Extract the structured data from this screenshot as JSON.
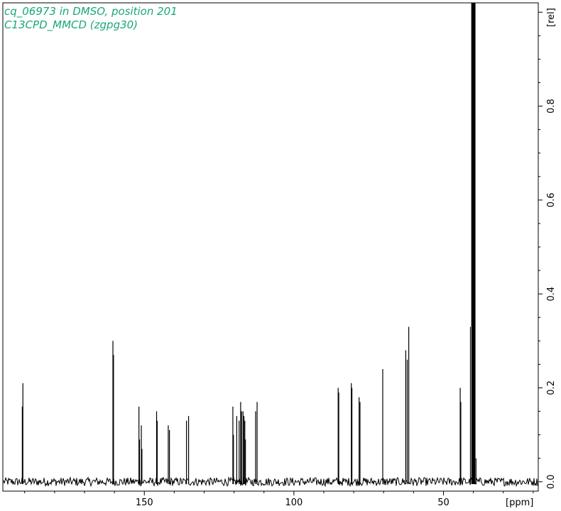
{
  "header": {
    "line1": "cq_06973 in DMSO, position 201",
    "line2": "C13CPD_MMCD (zgpg30)"
  },
  "colors": {
    "title": "#1aa874",
    "trace": "#000000",
    "frame": "#000000",
    "background": "#ffffff"
  },
  "chart_data": {
    "type": "line",
    "xlabel": "[ppm]",
    "ylabel": "[rel]",
    "x_reversed": true,
    "xlim": [
      197.3,
      18.3
    ],
    "ylim": [
      -0.02,
      1.02
    ],
    "x_ticks": [
      150,
      100,
      50
    ],
    "x_tick_labels": [
      "150",
      "100",
      "50"
    ],
    "y_ticks": [
      0.0,
      0.2,
      0.4,
      0.6,
      0.8
    ],
    "y_tick_labels": [
      "0.0",
      "0.2",
      "0.4",
      "0.6",
      "0.8"
    ],
    "solvent_peak": {
      "ppm_from": 39.3,
      "ppm_to": 40.7,
      "height": 1.02,
      "label": ""
    },
    "peaks": [
      {
        "ppm": 190.6,
        "height": 0.21
      },
      {
        "ppm": 190.8,
        "height": 0.16
      },
      {
        "ppm": 160.5,
        "height": 0.3
      },
      {
        "ppm": 160.3,
        "height": 0.27
      },
      {
        "ppm": 151.8,
        "height": 0.16
      },
      {
        "ppm": 151.6,
        "height": 0.09
      },
      {
        "ppm": 151.0,
        "height": 0.12
      },
      {
        "ppm": 150.8,
        "height": 0.07
      },
      {
        "ppm": 145.9,
        "height": 0.15
      },
      {
        "ppm": 145.7,
        "height": 0.13
      },
      {
        "ppm": 142.0,
        "height": 0.12
      },
      {
        "ppm": 141.6,
        "height": 0.11
      },
      {
        "ppm": 135.9,
        "height": 0.13
      },
      {
        "ppm": 135.2,
        "height": 0.14
      },
      {
        "ppm": 120.4,
        "height": 0.16
      },
      {
        "ppm": 120.2,
        "height": 0.1
      },
      {
        "ppm": 119.1,
        "height": 0.14
      },
      {
        "ppm": 118.3,
        "height": 0.13
      },
      {
        "ppm": 117.8,
        "height": 0.17
      },
      {
        "ppm": 117.5,
        "height": 0.15
      },
      {
        "ppm": 117.0,
        "height": 0.15
      },
      {
        "ppm": 116.7,
        "height": 0.14
      },
      {
        "ppm": 116.4,
        "height": 0.13
      },
      {
        "ppm": 116.2,
        "height": 0.09
      },
      {
        "ppm": 112.8,
        "height": 0.15
      },
      {
        "ppm": 112.3,
        "height": 0.17
      },
      {
        "ppm": 85.2,
        "height": 0.2
      },
      {
        "ppm": 85.0,
        "height": 0.19
      },
      {
        "ppm": 80.8,
        "height": 0.21
      },
      {
        "ppm": 80.6,
        "height": 0.2
      },
      {
        "ppm": 78.2,
        "height": 0.18
      },
      {
        "ppm": 77.9,
        "height": 0.17
      },
      {
        "ppm": 70.3,
        "height": 0.24
      },
      {
        "ppm": 62.6,
        "height": 0.28
      },
      {
        "ppm": 62.1,
        "height": 0.26
      },
      {
        "ppm": 61.6,
        "height": 0.33
      },
      {
        "ppm": 44.4,
        "height": 0.2
      },
      {
        "ppm": 44.2,
        "height": 0.17
      }
    ],
    "noise_amplitude": 0.009
  }
}
